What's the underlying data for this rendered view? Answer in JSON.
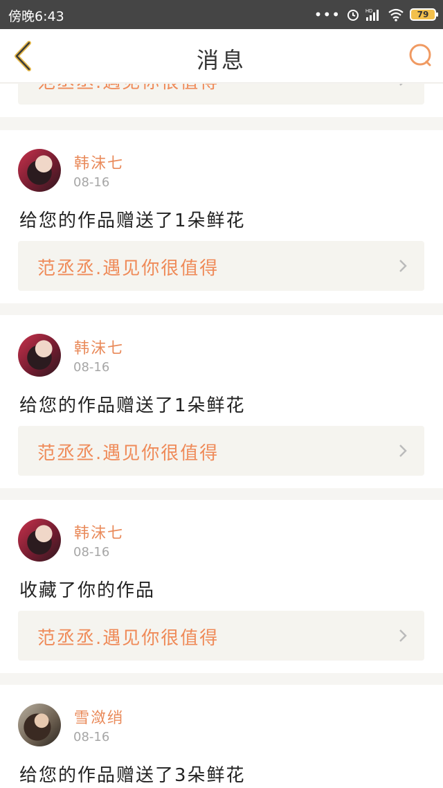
{
  "status_bar": {
    "time": "傍晚6:43",
    "dots": "•••",
    "battery": "79",
    "icons": [
      "alarm-icon",
      "hd-signal-icon",
      "wifi-icon",
      "battery-icon"
    ]
  },
  "nav": {
    "title": "消息",
    "back_icon": "back-icon",
    "search_icon": "search-icon"
  },
  "partial_item": {
    "work_title": "范丞丞.遇见你很值得"
  },
  "messages": [
    {
      "user": "韩沫七",
      "date": "08-16",
      "text": "给您的作品赠送了1朵鲜花",
      "work_title": "范丞丞.遇见你很值得"
    },
    {
      "user": "韩沫七",
      "date": "08-16",
      "text": "给您的作品赠送了1朵鲜花",
      "work_title": "范丞丞.遇见你很值得"
    },
    {
      "user": "韩沫七",
      "date": "08-16",
      "text": "收藏了你的作品",
      "work_title": "范丞丞.遇见你很值得"
    },
    {
      "user": "雪潋绡",
      "date": "08-16",
      "text": "给您的作品赠送了3朵鲜花"
    }
  ],
  "colors": {
    "accent": "#ef8a58",
    "status_bar_bg": "#454545",
    "page_bg": "#f6f5f2",
    "link_bg": "#f5f4ef"
  }
}
